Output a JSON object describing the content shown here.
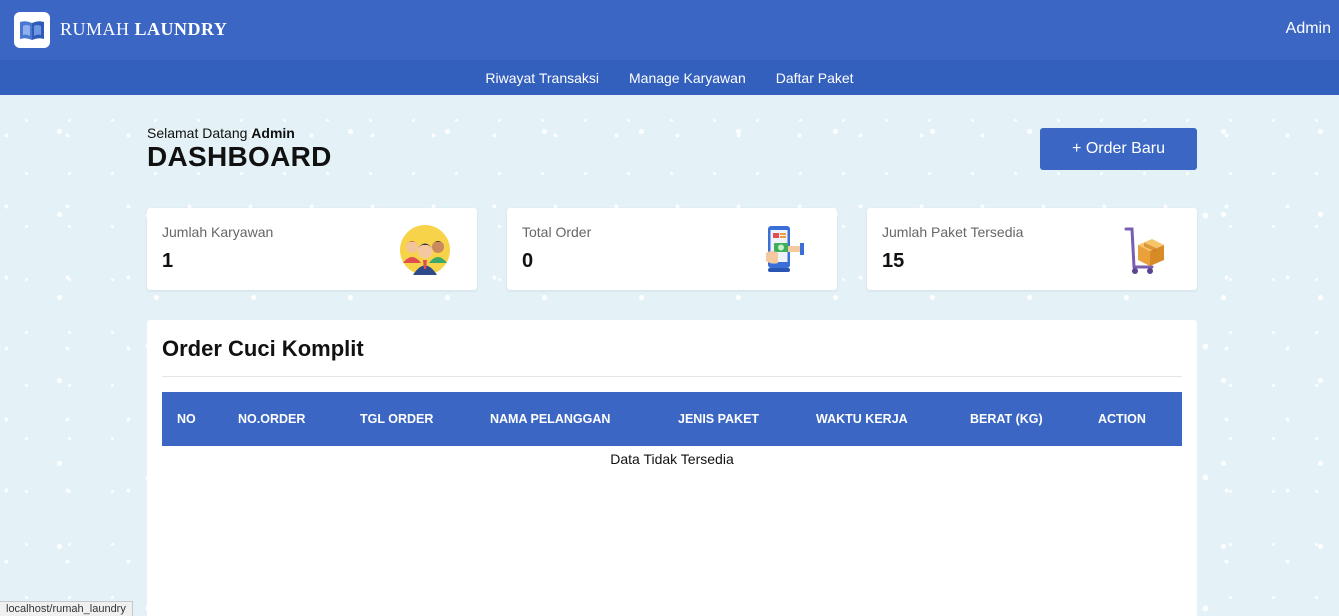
{
  "header": {
    "brand_prefix": "RUMAH",
    "brand_bold": "LAUNDRY",
    "user": "Admin"
  },
  "nav": {
    "items": [
      {
        "label": "Riwayat Transaksi"
      },
      {
        "label": "Manage Karyawan"
      },
      {
        "label": "Daftar Paket"
      }
    ]
  },
  "main": {
    "greeting": "Selamat Datang",
    "greeting_user": "Admin",
    "title": "DASHBOARD",
    "new_order_label": "+ Order Baru"
  },
  "stats": [
    {
      "label": "Jumlah Karyawan",
      "value": "1",
      "icon": "employees-icon"
    },
    {
      "label": "Total Order",
      "value": "0",
      "icon": "mobile-payment-icon"
    },
    {
      "label": "Jumlah Paket Tersedia",
      "value": "15",
      "icon": "package-trolley-icon"
    }
  ],
  "table": {
    "title": "Order Cuci Komplit",
    "columns": [
      "NO",
      "NO.ORDER",
      "TGL ORDER",
      "NAMA PELANGGAN",
      "JENIS PAKET",
      "WAKTU KERJA",
      "BERAT (KG)",
      "ACTION"
    ],
    "empty_text": "Data Tidak Tersedia"
  },
  "statusbar": {
    "url": "localhost/rumah_laundry"
  },
  "colors": {
    "primary": "#3b66c4",
    "nav": "#335fbd",
    "background": "#e4f2f8"
  }
}
